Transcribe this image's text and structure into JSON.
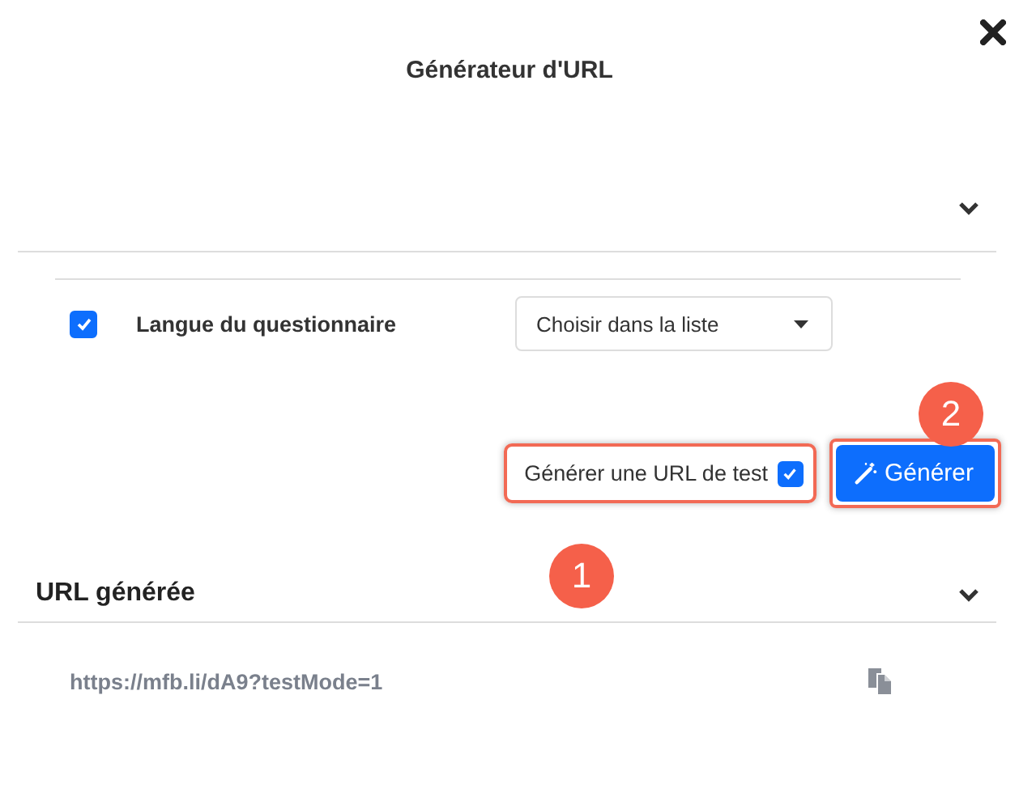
{
  "dialog": {
    "title": "Générateur d'URL"
  },
  "options_section": {
    "expanded": true
  },
  "language_option": {
    "checked": true,
    "label": "Langue du questionnaire",
    "select": {
      "value": "Choisir dans la liste"
    }
  },
  "test_url": {
    "label": "Générer une URL de test",
    "checked": true,
    "highlighted": true,
    "callout": "1"
  },
  "generate_button": {
    "label": "Générer",
    "highlighted": true,
    "callout": "2"
  },
  "generated_section": {
    "title": "URL générée",
    "url": "https://mfb.li/dA9?testMode=1"
  }
}
